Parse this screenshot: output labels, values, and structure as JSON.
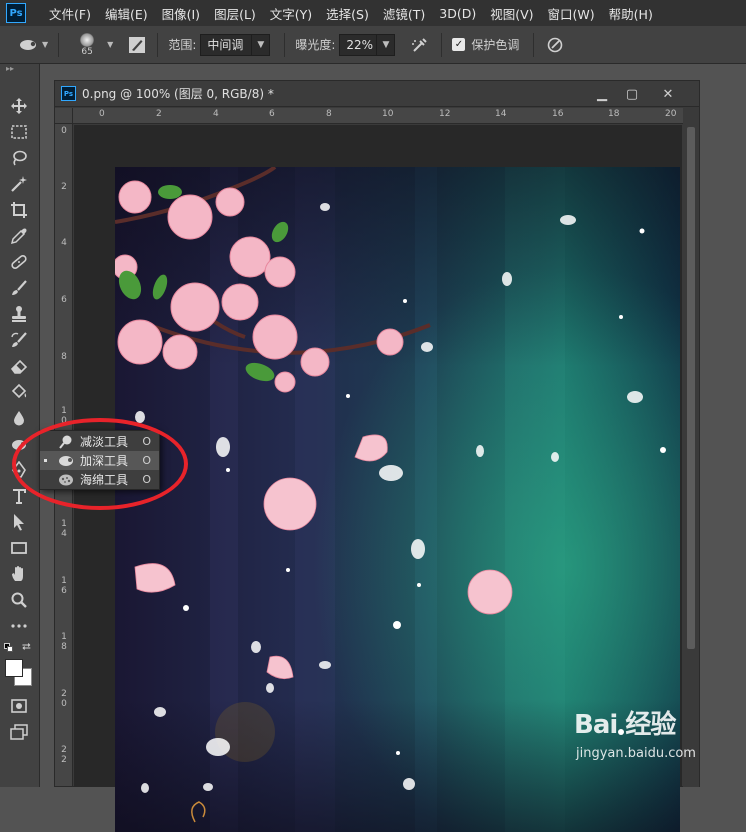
{
  "app": {
    "logo": "Ps",
    "menu": [
      "文件(F)",
      "编辑(E)",
      "图像(I)",
      "图层(L)",
      "文字(Y)",
      "选择(S)",
      "滤镜(T)",
      "3D(D)",
      "视图(V)",
      "窗口(W)",
      "帮助(H)"
    ]
  },
  "options": {
    "brush_size": "65",
    "range_label": "范围:",
    "range_value": "中间调",
    "exposure_label": "曝光度:",
    "exposure_value": "22%",
    "protect_tones_label": "保护色调",
    "protect_tones_checked": true
  },
  "document": {
    "title": "0.png @ 100% (图层 0, RGB/8) *",
    "ruler_top": [
      "0",
      "2",
      "4",
      "6",
      "8",
      "10",
      "12",
      "14",
      "16",
      "18",
      "20"
    ],
    "ruler_left": [
      "0",
      "2",
      "4",
      "6",
      "8",
      "1 0",
      "1 2",
      "1 4",
      "1 6",
      "1 8",
      "2 0",
      "2 2"
    ]
  },
  "flyout": {
    "items": [
      {
        "label": "减淡工具",
        "key": "O",
        "icon": "dodge-icon",
        "active": false
      },
      {
        "label": "加深工具",
        "key": "O",
        "icon": "burn-icon",
        "active": true
      },
      {
        "label": "海绵工具",
        "key": "O",
        "icon": "sponge-icon",
        "active": false
      }
    ]
  },
  "watermark": {
    "main": "Bai 经验",
    "sub": "jingyan.baidu.com"
  },
  "colors": {
    "annotation_red": "#e8232a",
    "ps_blue": "#31a8ff"
  }
}
